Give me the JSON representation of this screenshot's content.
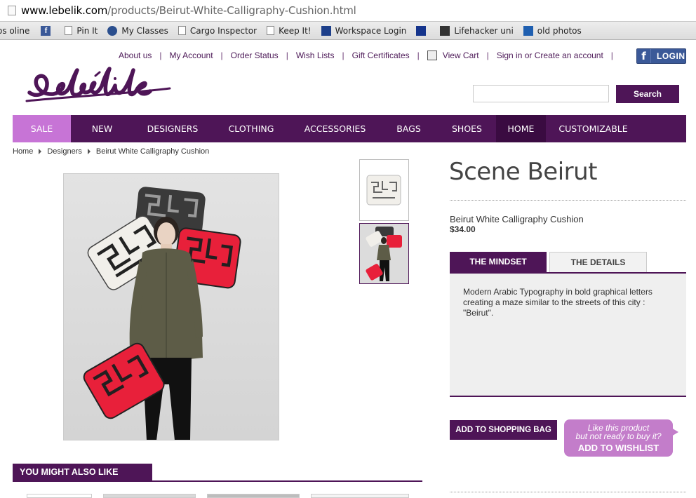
{
  "browser": {
    "url_domain": "www.lebelik.com",
    "url_path": "/products/Beirut-White-Calligraphy-Cushion.html",
    "bookmarks": [
      "os oline",
      "Pin It",
      "My Classes",
      "Cargo Inspector",
      "Keep It!",
      "Workspace Login",
      "Lifehacker uni",
      "old photos"
    ],
    "bookmark_icons": [
      "none",
      "facebook-icon",
      "document-icon",
      "classes-icon",
      "document-icon",
      "document-icon",
      "mail-icon",
      "download-icon",
      "lifehacker-icon",
      "photos-icon"
    ]
  },
  "header": {
    "top_links": [
      "About us",
      "My Account",
      "Order Status",
      "Wish Lists",
      "Gift Certificates",
      "View Cart",
      "Sign in or Create an account"
    ],
    "fb_login_label": "LOGIN",
    "fb_letter": "f",
    "logo_text": "Lebelik",
    "search_button": "Search",
    "search_value": ""
  },
  "nav": {
    "items": [
      "SALE",
      "NEW",
      "DESIGNERS",
      "CLOTHING",
      "ACCESSORIES",
      "BAGS",
      "SHOES",
      "HOME",
      "CUSTOMIZABLE"
    ],
    "active": "HOME",
    "highlight": "SALE"
  },
  "breadcrumb": [
    "Home",
    "Designers",
    "Beirut White Calligraphy Cushion"
  ],
  "product": {
    "brand": "Scene Beirut",
    "name": "Beirut White Calligraphy Cushion",
    "price": "$34.00",
    "tabs": [
      "THE MINDSET",
      "THE DETAILS"
    ],
    "active_tab": "THE MINDSET",
    "mindset_text": "Modern Arabic Typography in bold graphical letters creating a maze similar to the streets of this city : \"Beirut\".",
    "add_to_bag": "ADD TO SHOPPING BAG",
    "wishlist_line1": "Like this product",
    "wishlist_line2": "but not ready to buy it?",
    "wishlist_button": "ADD TO WISHLIST"
  },
  "recommendations": {
    "title": "YOU MIGHT ALSO LIKE"
  },
  "colors": {
    "brand_purple": "#4e1557",
    "sale_pink": "#c774d6",
    "wishlist_pink": "#c37dca",
    "facebook_blue": "#3b5998",
    "cushion_red": "#e8203a"
  }
}
